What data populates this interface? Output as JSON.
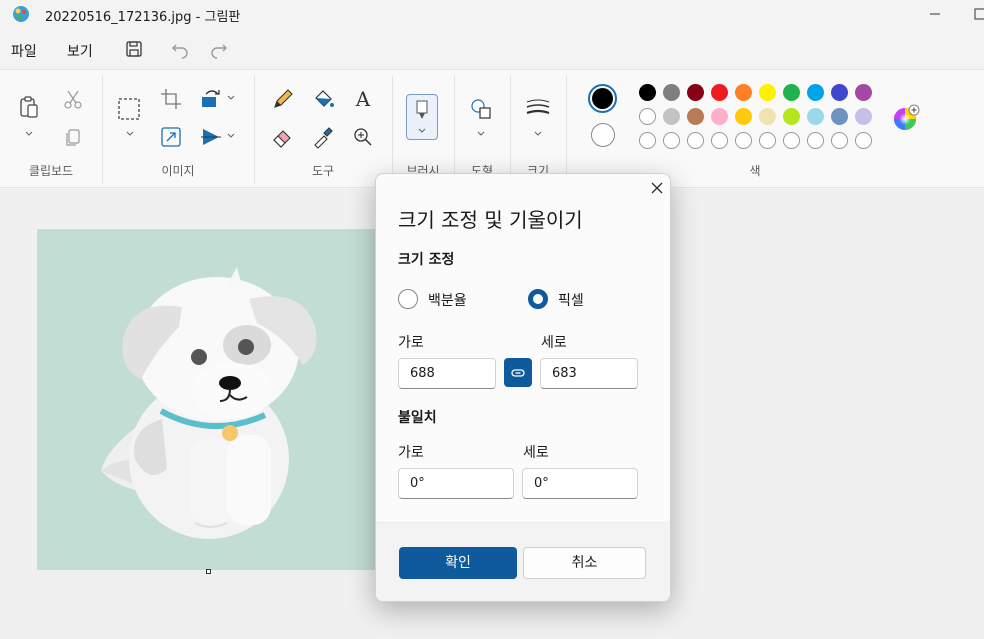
{
  "window": {
    "title": "20220516_172136.jpg - 그림판"
  },
  "menu": {
    "file": "파일",
    "view": "보기"
  },
  "ribbon": {
    "groups": {
      "clipboard": "클립보드",
      "image": "이미지",
      "tools": "도구",
      "brushes": "브러시",
      "shapes": "도형",
      "size": "크기",
      "colors": "색"
    },
    "palette_row1": [
      "#000000",
      "#7f7f7f",
      "#880015",
      "#ed1c24",
      "#ff7f27",
      "#fff200",
      "#22b14c",
      "#00a2e8",
      "#3f48cc",
      "#a349a4"
    ],
    "palette_row2": [
      "#ffffff",
      "#c3c3c3",
      "#b97a57",
      "#ffaec9",
      "#ffc90e",
      "#efe4b0",
      "#b5e61d",
      "#99d9ea",
      "#7092be",
      "#c8bfe7"
    ],
    "color1": "#000000",
    "color2": "#ffffff"
  },
  "dialog": {
    "title": "크기 조정 및 기울이기",
    "resize_heading": "크기 조정",
    "option_percent": "백분율",
    "option_pixel": "픽셀",
    "selected_option": "pixel",
    "horizontal_label": "가로",
    "vertical_label": "세로",
    "width_value": "688",
    "height_value": "683",
    "skew_heading": "불일치",
    "skew_horizontal_label": "가로",
    "skew_vertical_label": "세로",
    "skew_h_value": "0°",
    "skew_v_value": "0°",
    "ok_label": "확인",
    "cancel_label": "취소"
  }
}
